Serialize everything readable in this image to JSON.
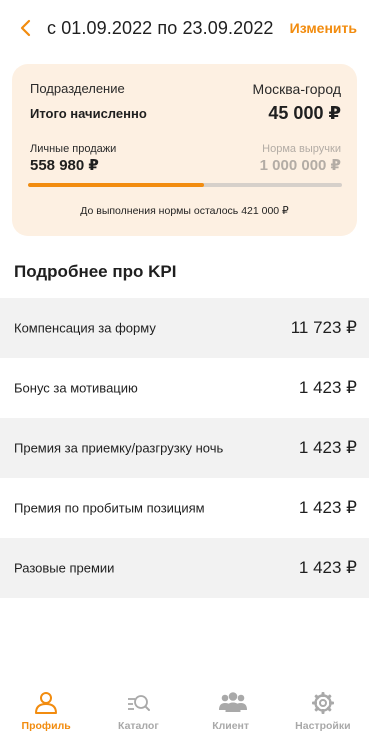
{
  "header": {
    "period": "с 01.09.2022 по 23.09.2022",
    "change_label": "Изменить"
  },
  "summary": {
    "division_label": "Подразделение",
    "division_value": "Москва-город",
    "total_label": "Итого начисленно",
    "total_value": "45 000 ₽",
    "sales_label": "Личные продажи",
    "sales_value": "558 980 ₽",
    "norm_label": "Норма выручки",
    "norm_value": "1 000 000 ₽",
    "progress_fraction": 0.559,
    "remaining_text": "До выполнения нормы осталось 421 000 ₽"
  },
  "kpi": {
    "title": "Подробнее про KPI",
    "items": [
      {
        "label": "Компенсация за форму",
        "value": "11 723 ₽"
      },
      {
        "label": "Бонус за мотивацию",
        "value": "1 423 ₽"
      },
      {
        "label": "Премия за приемку/разгрузку ночь",
        "value": "1 423 ₽"
      },
      {
        "label": "Премия по пробитым позициям",
        "value": "1 423 ₽"
      },
      {
        "label": "Разовые премии",
        "value": "1 423 ₽"
      }
    ]
  },
  "tabbar": {
    "tabs": [
      {
        "label": "Профиль",
        "icon": "profile-icon",
        "active": true
      },
      {
        "label": "Каталог",
        "icon": "catalog-search-icon",
        "active": false
      },
      {
        "label": "Клиент",
        "icon": "clients-icon",
        "active": false
      },
      {
        "label": "Настройки",
        "icon": "settings-gear-icon",
        "active": false
      }
    ]
  },
  "colors": {
    "accent": "#f28c0f",
    "card_background": "#fdf0e2",
    "row_shade": "#f2f2f2",
    "muted_text": "#b3aca5",
    "inactive_tab": "#a9a9a9"
  }
}
